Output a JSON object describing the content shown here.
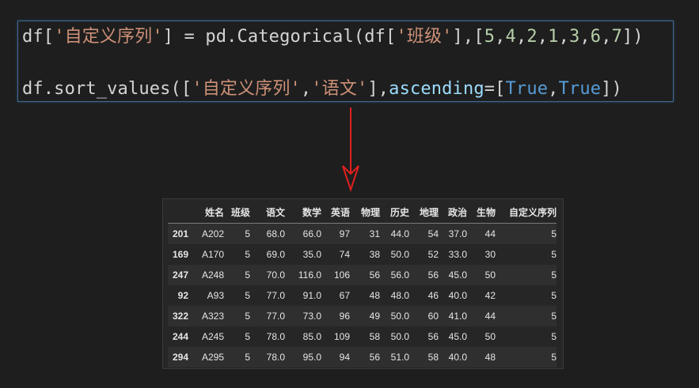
{
  "code": {
    "line1": [
      {
        "t": "df[",
        "c": "plain"
      },
      {
        "t": "'自定义序列'",
        "c": "str"
      },
      {
        "t": "] = pd.Categorical(df[",
        "c": "plain"
      },
      {
        "t": "'班级'",
        "c": "str"
      },
      {
        "t": "],[",
        "c": "plain"
      },
      {
        "t": "5",
        "c": "num"
      },
      {
        "t": ",",
        "c": "plain"
      },
      {
        "t": "4",
        "c": "num"
      },
      {
        "t": ",",
        "c": "plain"
      },
      {
        "t": "2",
        "c": "num"
      },
      {
        "t": ",",
        "c": "plain"
      },
      {
        "t": "1",
        "c": "num"
      },
      {
        "t": ",",
        "c": "plain"
      },
      {
        "t": "3",
        "c": "num"
      },
      {
        "t": ",",
        "c": "plain"
      },
      {
        "t": "6",
        "c": "num"
      },
      {
        "t": ",",
        "c": "plain"
      },
      {
        "t": "7",
        "c": "num"
      },
      {
        "t": "])",
        "c": "plain"
      }
    ],
    "line2": [
      {
        "t": "df.sort_values([",
        "c": "plain"
      },
      {
        "t": "'自定义序列'",
        "c": "str"
      },
      {
        "t": ",",
        "c": "plain"
      },
      {
        "t": "'语文'",
        "c": "str"
      },
      {
        "t": "],",
        "c": "plain"
      },
      {
        "t": "ascending",
        "c": "param"
      },
      {
        "t": "=[",
        "c": "plain"
      },
      {
        "t": "True",
        "c": "kw"
      },
      {
        "t": ",",
        "c": "plain"
      },
      {
        "t": "True",
        "c": "kw"
      },
      {
        "t": "])",
        "c": "plain"
      }
    ]
  },
  "arrow": {
    "color": "#e0201e",
    "icon": "arrow-down-icon"
  },
  "table": {
    "columns": [
      "",
      "姓名",
      "班级",
      "语文",
      "数学",
      "英语",
      "物理",
      "历史",
      "地理",
      "政治",
      "生物",
      "自定义序列"
    ],
    "rows": [
      [
        "201",
        "A202",
        "5",
        "68.0",
        "66.0",
        "97",
        "31",
        "44.0",
        "54",
        "37.0",
        "44",
        "5"
      ],
      [
        "169",
        "A170",
        "5",
        "69.0",
        "35.0",
        "74",
        "38",
        "50.0",
        "52",
        "33.0",
        "30",
        "5"
      ],
      [
        "247",
        "A248",
        "5",
        "70.0",
        "116.0",
        "106",
        "56",
        "56.0",
        "56",
        "45.0",
        "50",
        "5"
      ],
      [
        "92",
        "A93",
        "5",
        "77.0",
        "91.0",
        "67",
        "48",
        "48.0",
        "46",
        "40.0",
        "42",
        "5"
      ],
      [
        "322",
        "A323",
        "5",
        "77.0",
        "73.0",
        "96",
        "49",
        "50.0",
        "60",
        "41.0",
        "44",
        "5"
      ],
      [
        "244",
        "A245",
        "5",
        "78.0",
        "85.0",
        "109",
        "58",
        "50.0",
        "56",
        "45.0",
        "50",
        "5"
      ],
      [
        "294",
        "A295",
        "5",
        "78.0",
        "95.0",
        "94",
        "56",
        "51.0",
        "58",
        "40.0",
        "48",
        "5"
      ]
    ]
  }
}
